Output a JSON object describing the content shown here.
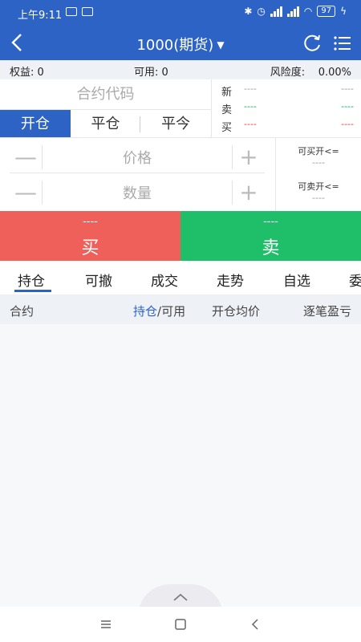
{
  "status_bar": {
    "time": "上午9:11",
    "battery": "97"
  },
  "nav": {
    "title": "1000(期货)",
    "caret": "▼"
  },
  "account": {
    "equity": "权益: 0",
    "available": "可用: 0",
    "risk_label": "风险度:",
    "risk_value": "0.00%"
  },
  "order_form": {
    "code_placeholder": "合约代码",
    "tabs": [
      "开仓",
      "平仓",
      "平今"
    ],
    "price_placeholder": "价格",
    "qty_placeholder": "数量",
    "minus": "—",
    "plus": "+"
  },
  "quote": {
    "rows": [
      {
        "label": "新",
        "v1": "----",
        "v2": "----"
      },
      {
        "label": "卖",
        "v1": "----",
        "v2": "----"
      },
      {
        "label": "买",
        "v1": "----",
        "v2": "----"
      }
    ]
  },
  "limits": {
    "can_buy_open": "可买开<=",
    "can_buy_value": "----",
    "can_sell_open": "可卖开<=",
    "can_sell_value": "----"
  },
  "trade": {
    "buy_price": "----",
    "buy_label": "买",
    "sell_price": "----",
    "sell_label": "卖"
  },
  "tabs": [
    "持仓",
    "可撤",
    "成交",
    "走势",
    "自选",
    "委"
  ],
  "table": {
    "col_contract": "合约",
    "col_position_hl": "持仓",
    "col_position_rest": "/可用",
    "col_avg_price": "开仓均价",
    "col_pnl": "逐笔盈亏"
  },
  "colors": {
    "primary": "#2e63c6",
    "buy": "#f0605a",
    "sell": "#1fbf6a"
  }
}
